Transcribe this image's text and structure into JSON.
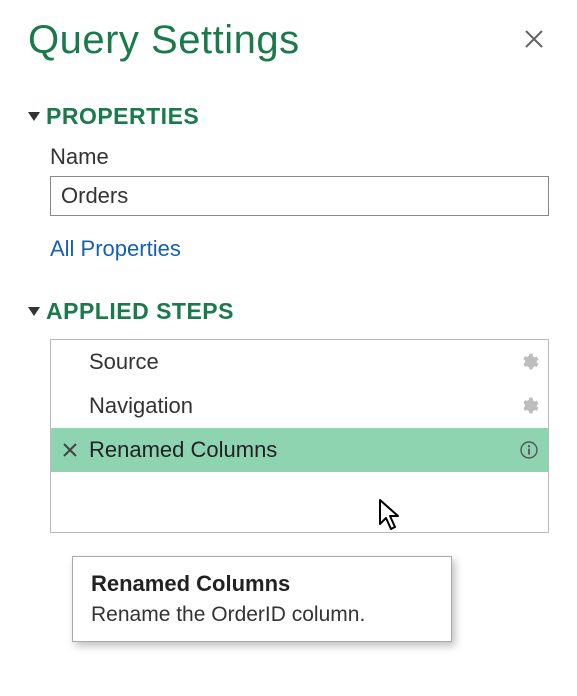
{
  "panel": {
    "title": "Query Settings"
  },
  "properties": {
    "heading": "PROPERTIES",
    "name_label": "Name",
    "name_value": "Orders",
    "all_properties_link": "All Properties"
  },
  "steps": {
    "heading": "APPLIED STEPS",
    "items": [
      {
        "label": "Source",
        "has_gear": true,
        "has_info": false,
        "selected": false
      },
      {
        "label": "Navigation",
        "has_gear": true,
        "has_info": false,
        "selected": false
      },
      {
        "label": "Renamed Columns",
        "has_gear": false,
        "has_info": true,
        "selected": true
      }
    ]
  },
  "tooltip": {
    "title": "Renamed Columns",
    "description": "Rename the OrderID column."
  }
}
